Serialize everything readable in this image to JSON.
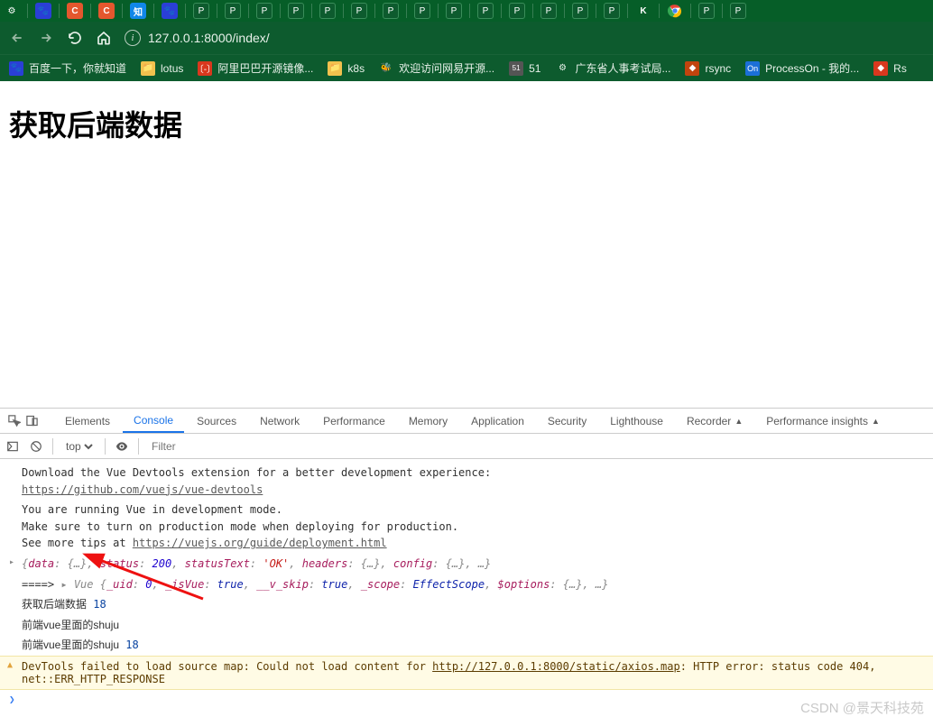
{
  "browser": {
    "url": "127.0.0.1:8000/index/"
  },
  "bookmarks": [
    {
      "label": "百度一下，你就知道",
      "icon": "baidu"
    },
    {
      "label": "lotus",
      "icon": "folder"
    },
    {
      "label": "阿里巴巴开源镜像...",
      "icon": "red"
    },
    {
      "label": "k8s",
      "icon": "folder"
    },
    {
      "label": "欢迎访问网易开源...",
      "icon": "bee"
    },
    {
      "label": "51",
      "icon": "51"
    },
    {
      "label": "广东省人事考试局...",
      "icon": "gear"
    },
    {
      "label": "rsync",
      "icon": "rsync"
    },
    {
      "label": "ProcessOn - 我的...",
      "icon": "on"
    },
    {
      "label": "Rs",
      "icon": "red"
    }
  ],
  "page": {
    "heading": "获取后端数据"
  },
  "devtools": {
    "tabs": [
      "Elements",
      "Console",
      "Sources",
      "Network",
      "Performance",
      "Memory",
      "Application",
      "Security",
      "Lighthouse",
      "Recorder",
      "Performance insights"
    ],
    "active_tab": "Console",
    "context": "top",
    "filter_placeholder": "Filter"
  },
  "console": {
    "msg1_a": "Download the Vue Devtools extension for a better development experience:",
    "msg1_link": "https://github.com/vuejs/vue-devtools",
    "msg2_a": "You are running Vue in development mode.",
    "msg2_b": "Make sure to turn on production mode when deploying for production.",
    "msg2_c": "See more tips at ",
    "msg2_link": "https://vuejs.org/guide/deployment.html",
    "obj1": {
      "prefix": "{",
      "parts": "data: {…}, status: 200, statusText: 'OK', headers: {…}, config: {…}, …",
      "suffix": "}"
    },
    "line_arrow": "====> ",
    "obj2": "Vue {_uid: 0, _isVue: true, __v_skip: true, _scope: EffectScope, $options: {…}, …}",
    "line5_text": "获取后端数据",
    "line5_val": "18",
    "line6": "前端vue里面的shuju",
    "line7_text": "前端vue里面的shuju",
    "line7_val": "18",
    "warn_a": "DevTools failed to load source map: Could not load content for ",
    "warn_link": "http://127.0.0.1:8000/static/axios.map",
    "warn_b": ": HTTP error: status code 404, net::ERR_HTTP_RESPONSE"
  },
  "watermark": "CSDN @景天科技苑"
}
